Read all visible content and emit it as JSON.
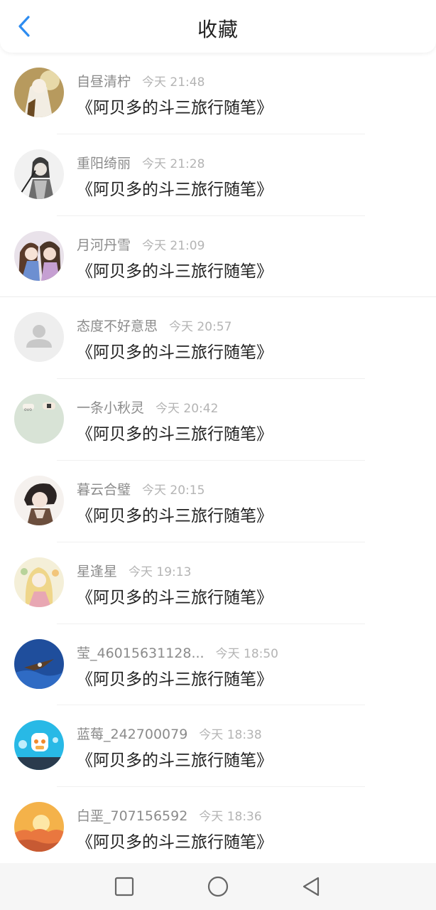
{
  "header": {
    "title": "收藏"
  },
  "favorites": [
    {
      "user": "自昼清柠",
      "time": "今天 21:48",
      "book": "《阿贝多的斗三旅行随笔》"
    },
    {
      "user": "重阳绮丽",
      "time": "今天 21:28",
      "book": "《阿贝多的斗三旅行随笔》"
    },
    {
      "user": "月河丹雪",
      "time": "今天 21:09",
      "book": "《阿贝多的斗三旅行随笔》"
    },
    {
      "user": "态度不好意思",
      "time": "今天 20:57",
      "book": "《阿贝多的斗三旅行随笔》"
    },
    {
      "user": "一条小秋灵",
      "time": "今天 20:42",
      "book": "《阿贝多的斗三旅行随笔》"
    },
    {
      "user": "暮云合璧",
      "time": "今天 20:15",
      "book": "《阿贝多的斗三旅行随笔》"
    },
    {
      "user": "星逢星",
      "time": "今天 19:13",
      "book": "《阿贝多的斗三旅行随笔》"
    },
    {
      "user": "莹_46015631128...",
      "time": "今天 18:50",
      "book": "《阿贝多的斗三旅行随笔》"
    },
    {
      "user": "蓝莓_242700079",
      "time": "今天 18:38",
      "book": "《阿贝多的斗三旅行随笔》"
    },
    {
      "user": "白垩_707156592",
      "time": "今天 18:36",
      "book": "《阿贝多的斗三旅行随笔》"
    }
  ],
  "navbar": {
    "icons": [
      "square-recents-icon",
      "circle-home-icon",
      "triangle-back-icon"
    ]
  },
  "colors": {
    "accent": "#2d8cf0",
    "text": "#222222",
    "meta": "#8b8b8b",
    "time": "#b4b4b4"
  }
}
